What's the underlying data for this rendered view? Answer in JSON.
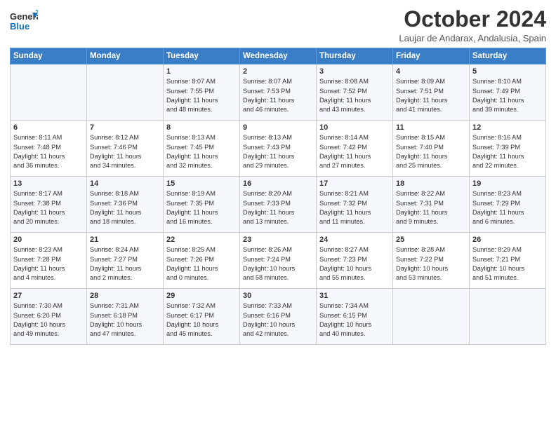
{
  "header": {
    "logo_line1": "General",
    "logo_line2": "Blue",
    "month": "October 2024",
    "location": "Laujar de Andarax, Andalusia, Spain"
  },
  "weekdays": [
    "Sunday",
    "Monday",
    "Tuesday",
    "Wednesday",
    "Thursday",
    "Friday",
    "Saturday"
  ],
  "weeks": [
    [
      {
        "day": "",
        "detail": ""
      },
      {
        "day": "",
        "detail": ""
      },
      {
        "day": "1",
        "detail": "Sunrise: 8:07 AM\nSunset: 7:55 PM\nDaylight: 11 hours\nand 48 minutes."
      },
      {
        "day": "2",
        "detail": "Sunrise: 8:07 AM\nSunset: 7:53 PM\nDaylight: 11 hours\nand 46 minutes."
      },
      {
        "day": "3",
        "detail": "Sunrise: 8:08 AM\nSunset: 7:52 PM\nDaylight: 11 hours\nand 43 minutes."
      },
      {
        "day": "4",
        "detail": "Sunrise: 8:09 AM\nSunset: 7:51 PM\nDaylight: 11 hours\nand 41 minutes."
      },
      {
        "day": "5",
        "detail": "Sunrise: 8:10 AM\nSunset: 7:49 PM\nDaylight: 11 hours\nand 39 minutes."
      }
    ],
    [
      {
        "day": "6",
        "detail": "Sunrise: 8:11 AM\nSunset: 7:48 PM\nDaylight: 11 hours\nand 36 minutes."
      },
      {
        "day": "7",
        "detail": "Sunrise: 8:12 AM\nSunset: 7:46 PM\nDaylight: 11 hours\nand 34 minutes."
      },
      {
        "day": "8",
        "detail": "Sunrise: 8:13 AM\nSunset: 7:45 PM\nDaylight: 11 hours\nand 32 minutes."
      },
      {
        "day": "9",
        "detail": "Sunrise: 8:13 AM\nSunset: 7:43 PM\nDaylight: 11 hours\nand 29 minutes."
      },
      {
        "day": "10",
        "detail": "Sunrise: 8:14 AM\nSunset: 7:42 PM\nDaylight: 11 hours\nand 27 minutes."
      },
      {
        "day": "11",
        "detail": "Sunrise: 8:15 AM\nSunset: 7:40 PM\nDaylight: 11 hours\nand 25 minutes."
      },
      {
        "day": "12",
        "detail": "Sunrise: 8:16 AM\nSunset: 7:39 PM\nDaylight: 11 hours\nand 22 minutes."
      }
    ],
    [
      {
        "day": "13",
        "detail": "Sunrise: 8:17 AM\nSunset: 7:38 PM\nDaylight: 11 hours\nand 20 minutes."
      },
      {
        "day": "14",
        "detail": "Sunrise: 8:18 AM\nSunset: 7:36 PM\nDaylight: 11 hours\nand 18 minutes."
      },
      {
        "day": "15",
        "detail": "Sunrise: 8:19 AM\nSunset: 7:35 PM\nDaylight: 11 hours\nand 16 minutes."
      },
      {
        "day": "16",
        "detail": "Sunrise: 8:20 AM\nSunset: 7:33 PM\nDaylight: 11 hours\nand 13 minutes."
      },
      {
        "day": "17",
        "detail": "Sunrise: 8:21 AM\nSunset: 7:32 PM\nDaylight: 11 hours\nand 11 minutes."
      },
      {
        "day": "18",
        "detail": "Sunrise: 8:22 AM\nSunset: 7:31 PM\nDaylight: 11 hours\nand 9 minutes."
      },
      {
        "day": "19",
        "detail": "Sunrise: 8:23 AM\nSunset: 7:29 PM\nDaylight: 11 hours\nand 6 minutes."
      }
    ],
    [
      {
        "day": "20",
        "detail": "Sunrise: 8:23 AM\nSunset: 7:28 PM\nDaylight: 11 hours\nand 4 minutes."
      },
      {
        "day": "21",
        "detail": "Sunrise: 8:24 AM\nSunset: 7:27 PM\nDaylight: 11 hours\nand 2 minutes."
      },
      {
        "day": "22",
        "detail": "Sunrise: 8:25 AM\nSunset: 7:26 PM\nDaylight: 11 hours\nand 0 minutes."
      },
      {
        "day": "23",
        "detail": "Sunrise: 8:26 AM\nSunset: 7:24 PM\nDaylight: 10 hours\nand 58 minutes."
      },
      {
        "day": "24",
        "detail": "Sunrise: 8:27 AM\nSunset: 7:23 PM\nDaylight: 10 hours\nand 55 minutes."
      },
      {
        "day": "25",
        "detail": "Sunrise: 8:28 AM\nSunset: 7:22 PM\nDaylight: 10 hours\nand 53 minutes."
      },
      {
        "day": "26",
        "detail": "Sunrise: 8:29 AM\nSunset: 7:21 PM\nDaylight: 10 hours\nand 51 minutes."
      }
    ],
    [
      {
        "day": "27",
        "detail": "Sunrise: 7:30 AM\nSunset: 6:20 PM\nDaylight: 10 hours\nand 49 minutes."
      },
      {
        "day": "28",
        "detail": "Sunrise: 7:31 AM\nSunset: 6:18 PM\nDaylight: 10 hours\nand 47 minutes."
      },
      {
        "day": "29",
        "detail": "Sunrise: 7:32 AM\nSunset: 6:17 PM\nDaylight: 10 hours\nand 45 minutes."
      },
      {
        "day": "30",
        "detail": "Sunrise: 7:33 AM\nSunset: 6:16 PM\nDaylight: 10 hours\nand 42 minutes."
      },
      {
        "day": "31",
        "detail": "Sunrise: 7:34 AM\nSunset: 6:15 PM\nDaylight: 10 hours\nand 40 minutes."
      },
      {
        "day": "",
        "detail": ""
      },
      {
        "day": "",
        "detail": ""
      }
    ]
  ]
}
